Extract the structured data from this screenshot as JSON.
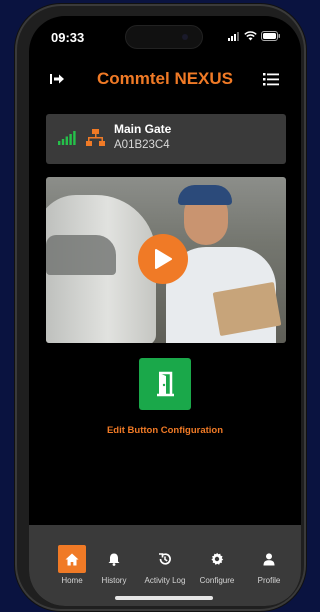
{
  "status_bar": {
    "time": "09:33"
  },
  "header": {
    "title": "Commtel NEXUS"
  },
  "gate": {
    "name": "Main Gate",
    "id": "A01B23C4"
  },
  "actions": {
    "edit_config_label": "Edit Button Configuration"
  },
  "tabbar": {
    "active": "Home",
    "items": [
      {
        "label": "Home",
        "icon": "home-icon"
      },
      {
        "label": "History",
        "icon": "bell-icon"
      },
      {
        "label": "Activity Log",
        "icon": "history-icon"
      },
      {
        "label": "Configure",
        "icon": "gear-icon"
      },
      {
        "label": "Profile",
        "icon": "user-icon"
      }
    ]
  },
  "colors": {
    "accent": "#f07a26",
    "door_green": "#1aa84a",
    "signal_green": "#25c14a",
    "card_bg": "#3a3a3a"
  }
}
